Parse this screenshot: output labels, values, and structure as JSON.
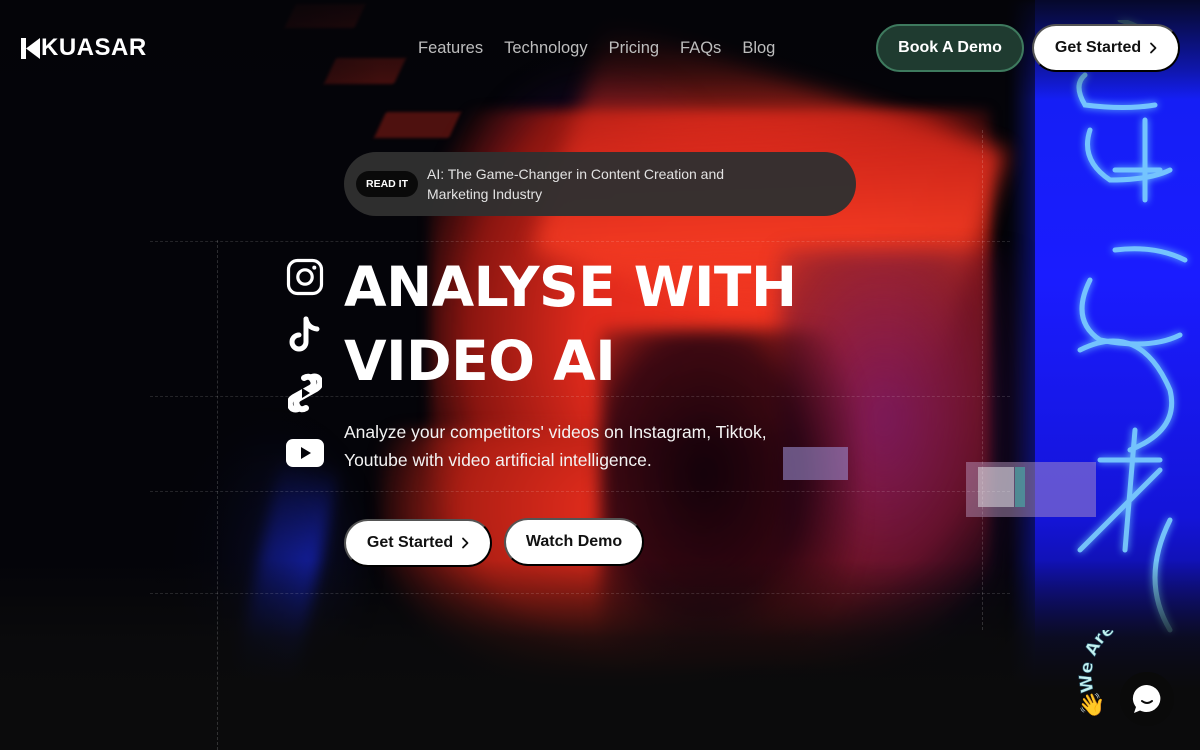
{
  "brand": {
    "name": "KUASAR",
    "logo_icon": "kuasar-k-mark"
  },
  "nav": {
    "items": [
      {
        "label": "Features"
      },
      {
        "label": "Technology"
      },
      {
        "label": "Pricing"
      },
      {
        "label": "FAQs"
      },
      {
        "label": "Blog"
      }
    ]
  },
  "header_actions": {
    "book_demo": "Book A Demo",
    "get_started": "Get Started",
    "get_started_icon": "chevron-right"
  },
  "announcement": {
    "badge": "READ IT",
    "text": "AI: The Game-Changer in Content Creation and Marketing Industry"
  },
  "hero": {
    "headline_line1": "ANALYSE WITH",
    "headline_line2": "VIDEO AI",
    "subtitle": "Analyze your competitors' videos on Instagram, Tiktok, Youtube with video artificial intelligence.",
    "primary_cta": "Get Started",
    "secondary_cta": "Watch Demo",
    "social_icons": [
      "instagram",
      "tiktok",
      "youtube-shorts",
      "youtube"
    ]
  },
  "chat_widget": {
    "label": "We Are Here!",
    "icons": [
      "waving-hand",
      "chat-bubble"
    ]
  },
  "colors": {
    "background": "#0b0b0c",
    "demo_button_bg": "#1f3b30",
    "demo_button_border": "#3e7a5e",
    "pill_bg": "#303030",
    "accent_red": "#e62d1d",
    "accent_blue": "#1a1cff",
    "chat_label": "#bff0f0"
  }
}
